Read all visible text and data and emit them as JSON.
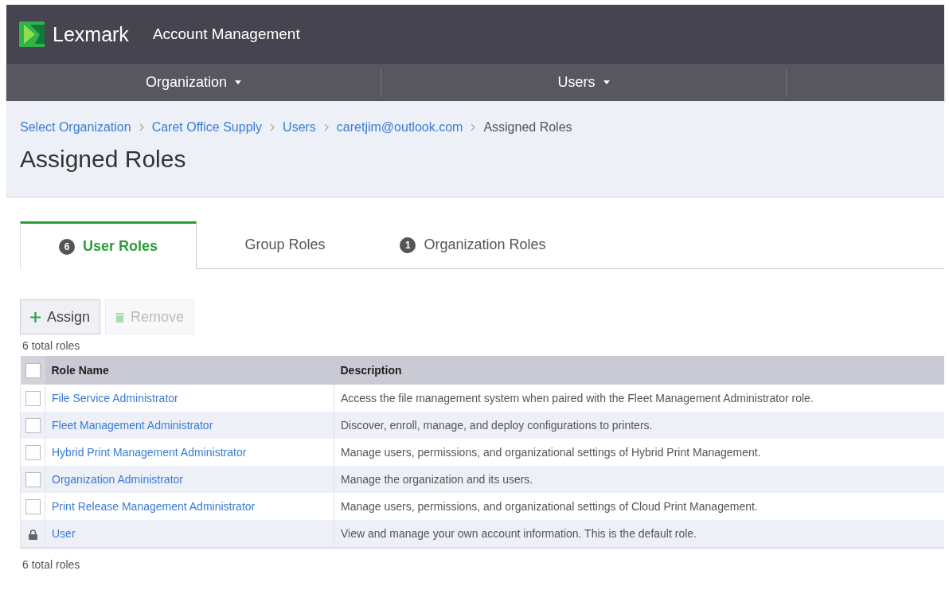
{
  "header": {
    "brand": "Lexmark",
    "app_title": "Account Management"
  },
  "nav": [
    {
      "label": "Organization",
      "dropdown": true
    },
    {
      "label": "Users",
      "dropdown": true
    }
  ],
  "breadcrumb": [
    {
      "label": "Select Organization",
      "link": true
    },
    {
      "label": "Caret Office Supply",
      "link": true
    },
    {
      "label": "Users",
      "link": true
    },
    {
      "label": "caretjim@outlook.com",
      "link": true
    },
    {
      "label": "Assigned Roles",
      "link": false
    }
  ],
  "page_title": "Assigned Roles",
  "tabs": [
    {
      "label": "User Roles",
      "count": "6",
      "selected": true
    },
    {
      "label": "Group Roles",
      "selected": false
    },
    {
      "label": "Organization Roles",
      "count": "1",
      "selected": false
    }
  ],
  "toolbar": [
    {
      "kind": "assign",
      "label": "Assign",
      "disabled": false
    },
    {
      "kind": "remove",
      "label": "Remove",
      "disabled": true
    }
  ],
  "total_top": "6 total roles",
  "table": {
    "select_all_checked": false,
    "columns": [
      "Role Name",
      "Description"
    ],
    "rows": [
      {
        "kind": "checkbox",
        "checked": false,
        "name": "File Service Administrator",
        "description": "Access the file management system when paired with the Fleet Management Administrator role."
      },
      {
        "kind": "checkbox",
        "checked": false,
        "name": "Fleet Management Administrator",
        "description": "Discover, enroll, manage, and deploy configurations to printers."
      },
      {
        "kind": "checkbox",
        "checked": false,
        "name": "Hybrid Print Management Administrator",
        "description": "Manage users, permissions, and organizational settings of Hybrid Print Management."
      },
      {
        "kind": "checkbox",
        "checked": false,
        "name": "Organization Administrator",
        "description": "Manage the organization and its users."
      },
      {
        "kind": "checkbox",
        "checked": false,
        "name": "Print Release Management Administrator",
        "description": "Manage users, permissions, and organizational settings of Cloud Print Management."
      },
      {
        "kind": "locked",
        "name": "User",
        "description": "View and manage your own account information. This is the default role."
      }
    ]
  },
  "total_bottom": "6 total roles"
}
